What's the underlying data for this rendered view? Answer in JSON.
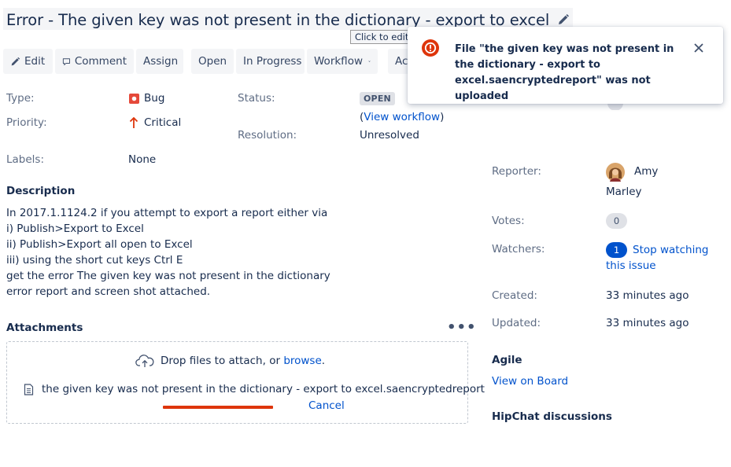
{
  "issue": {
    "title": "Error - The given key was not present in the dictionary - export to excel",
    "edit_tooltip": "Click to edit"
  },
  "toolbar": {
    "edit": "Edit",
    "comment": "Comment",
    "assign": "Assign",
    "open": "Open",
    "in_progress": "In Progress",
    "workflow": "Workflow",
    "admin_partial": "Ac"
  },
  "details": {
    "type_label": "Type:",
    "type_value": "Bug",
    "priority_label": "Priority:",
    "priority_value": "Critical",
    "labels_label": "Labels:",
    "labels_value": "None",
    "status_label": "Status:",
    "status_value": "OPEN",
    "view_workflow_open": "(",
    "view_workflow": "View workflow",
    "view_workflow_close": ")",
    "resolution_label": "Resolution:",
    "resolution_value": "Unresolved"
  },
  "description": {
    "heading": "Description",
    "lines": [
      "In 2017.1.1124.2 if you attempt to export a report either via",
      "i) Publish>Export to Excel",
      "ii) Publish>Export all open to Excel",
      "iii) using the short cut keys Ctrl E",
      "get the error The given key was not present in the dictionary",
      "error report and screen shot attached."
    ]
  },
  "attachments": {
    "heading": "Attachments",
    "more": "•••",
    "drop_text": "Drop files to attach, or ",
    "browse": "browse",
    "drop_end": ".",
    "file_name": "the given key was not present in the dictionary - export to excel.saencryptedreport",
    "upload_progress_percent": 50,
    "cancel": "Cancel"
  },
  "people": {
    "reporter_label": "Reporter:",
    "reporter_first": "Amy",
    "reporter_last": "Marley",
    "votes_label": "Votes:",
    "votes_count": "0",
    "watchers_label": "Watchers:",
    "watchers_count": "1",
    "stop_watching_1": "Stop watching",
    "stop_watching_2": "this issue"
  },
  "dates": {
    "created_label": "Created:",
    "created_value": "33 minutes ago",
    "updated_label": "Updated:",
    "updated_value": "33 minutes ago"
  },
  "agile": {
    "heading": "Agile",
    "view_on_board": "View on Board"
  },
  "hipchat": {
    "heading": "HipChat discussions"
  },
  "flag": {
    "message": "File \"the given key was not present in the dictionary - export to excel.saencryptedreport\" was not uploaded",
    "icon": "error-icon",
    "close_icon": "close-icon"
  },
  "colors": {
    "link": "#0052cc",
    "error_red": "#de350b",
    "bug_red": "#e5493a",
    "text": "#172b4d",
    "muted": "#5e6c84"
  }
}
